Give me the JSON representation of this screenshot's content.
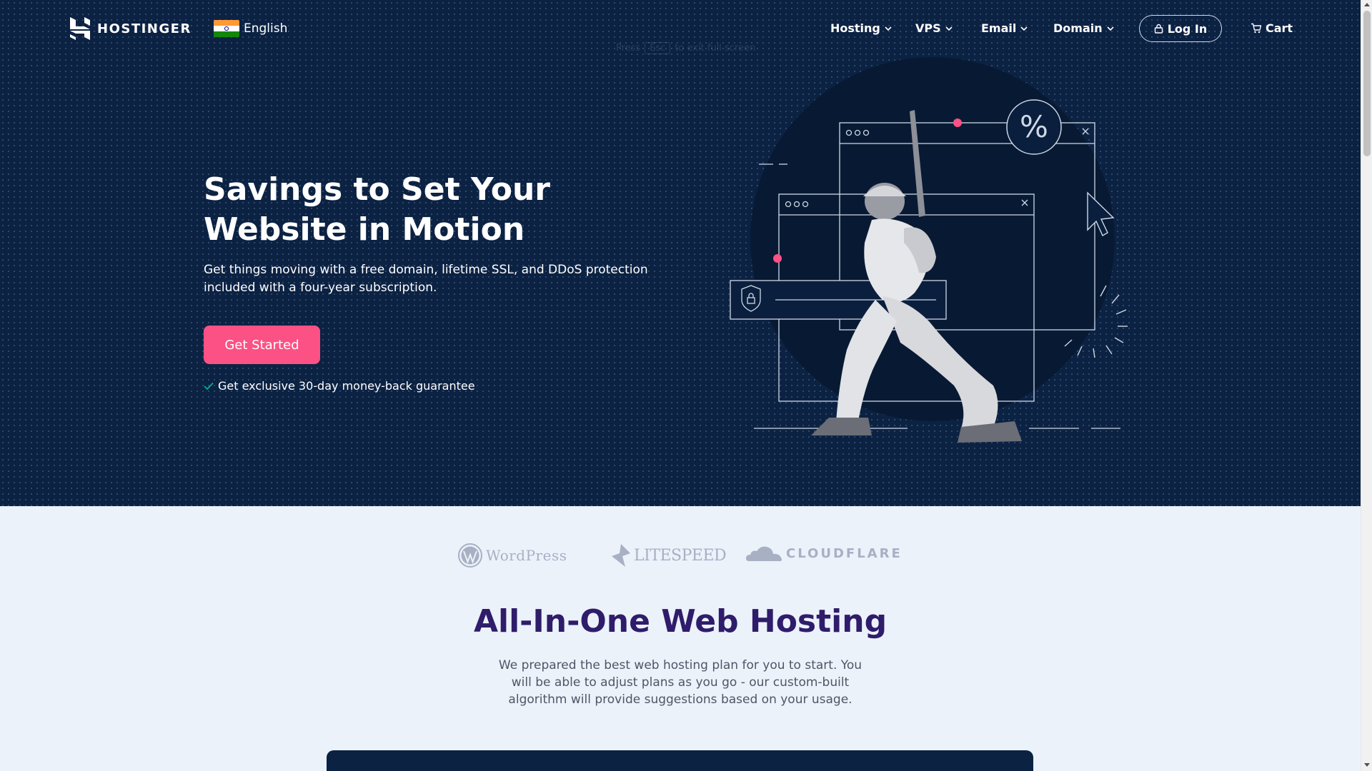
{
  "header": {
    "brand": "HOSTINGER",
    "language": "English",
    "nav": [
      "Hosting",
      "VPS",
      "Email",
      "Domain"
    ],
    "login": "Log In",
    "cart": "Cart",
    "esc_hint": {
      "prefix": "Press",
      "key": "Esc",
      "suffix": "to exit full screen"
    }
  },
  "hero": {
    "title": "Savings to Set Your Website in Motion",
    "subtitle": "Get things moving with a free domain, lifetime SSL, and DDoS protection included with a four-year subscription.",
    "cta": "Get Started",
    "guarantee": "Get exclusive 30-day money-back guarantee",
    "illustration_symbol": "%"
  },
  "partners": {
    "wordpress": "WordPress",
    "litespeed": "LITESPEED",
    "cloudflare": "CLOUDFLARE"
  },
  "section": {
    "title": "All-In-One Web Hosting",
    "description": "We prepared the best web hosting plan for you to start. You will be able to adjust plans as you go - our custom-built algorithm will provide suggestions based on your usage."
  },
  "colors": {
    "hero_bg": "#0c2243",
    "accent": "#fc5185",
    "page_bg": "#ebf2fa",
    "heading": "#2f1c6a"
  }
}
